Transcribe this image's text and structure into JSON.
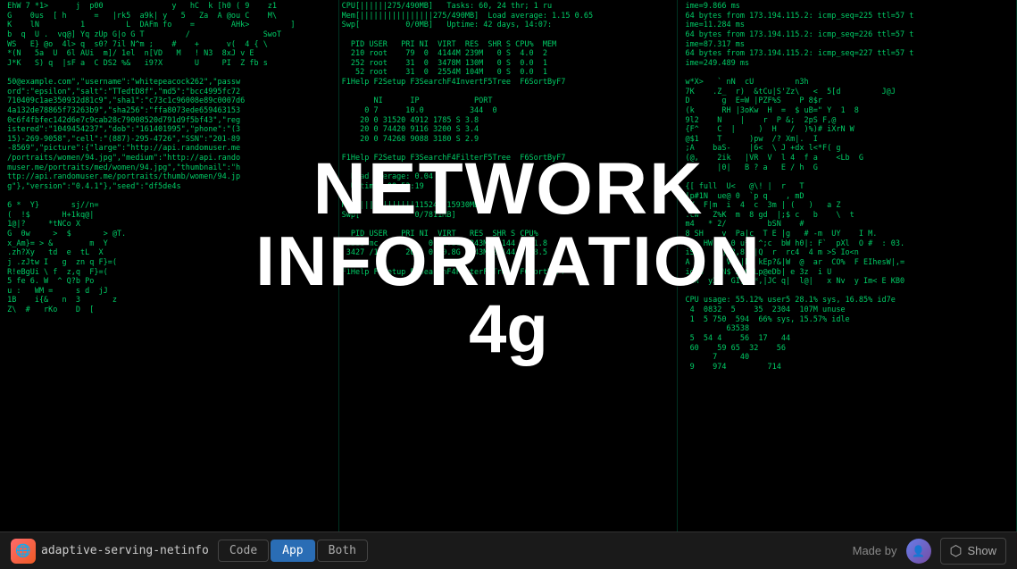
{
  "app": {
    "icon": "🌐",
    "name": "adaptive-serving-netinfo",
    "tabs": [
      {
        "id": "code",
        "label": "Code",
        "active": false
      },
      {
        "id": "app",
        "label": "App",
        "active": true
      },
      {
        "id": "both",
        "label": "Both",
        "active": false
      }
    ]
  },
  "overlay": {
    "line1": "NETWORK",
    "line2": "INFORMATION",
    "line3": "4g"
  },
  "bottom": {
    "made_by": "Made by",
    "show_label": "Show"
  },
  "terminal": {
    "col1_lines": [
      " EhW 7 *1>      j  p00               y   hC  k [h0 ( 9    z1",
      " G    0us  [ h      =   |rk5  a9k| y   5   Za  A @ou C    M\\",
      " K    lN         1         L  DAFm fo    =        AHk>         ]",
      " b  q  U .  vq@] Yq zUp G|o G T         /                SwoT",
      " WS   E} @o  4l> q  s0? 7il N^m ;    #    +      v(  4 { \\",
      " *(N   5a  U  6l AUi  m]/ 1el  n[VD   M   ! N3  8xJ v E",
      " J*K   S) q  |sF a  C DS2 %&   i9?X       U     PI  Z fb s",
      "",
      " 50@example.com\",\"username\":\"whitepeacock262\",\"passw",
      " ord\":\"epsilon\",\"salt\":\"TTedtD8f\",\"md5\":\"bcc4995fc72",
      " 710409c1ae350932d81c9\",\"sha1\":\"c73c1c96008e89c0007d6",
      " 4a132de78865f73263b9\",\"sha256\":\"ffa8073ede659463153",
      " 0c6f4fbfec142d6e7c9cab28c79008520d791d9f5bf43\",\"reg",
      " istered\":\"1049454237\",\"dob\":\"161401995\",\"phone\":\"(3",
      " 15)-269-9058\",\"cell\":\"(887)-295-4726\",\"SSN\":\"201-89",
      " -8569\",\"picture\":{\"large\":\"http://api.randomuser.me",
      " /portraits/women/94.jpg\",\"medium\":\"http://api.rando",
      " muser.me/portraits/med/women/94.jpg\",\"thumbnail\":\"h",
      " ttp://api.randomuser.me/portraits/thumb/women/94.jp",
      " g\"},\"version\":\"0.4.1\"},\"seed\":\"df5de4s",
      "",
      " 6 *  Y}       sj//n=          ",
      " (  !$       H+1kq@|",
      " 1@|?     *tNCo X",
      " G  0w     >  $       > @T.",
      " x_Am}= > &        m  Y",
      " .zh?Xy   td  e  tL  X",
      " j .zJtw I   g  zn q F}=(",
      " R!eBgUi \\ f  z,q  F}=(",
      " 5 fe 6. W  ^ Q?b Po",
      " u :   WM =     s d  jJ",
      " 1B    i{&   n  3       z",
      " Z\\  #   rKo    D  ["
    ],
    "col2_lines": [
      "CPU[||||||275/490MB]   Tasks: 60, 24 thr; 1 ru",
      "Mem[||||||||||||||||275/490MB]  Load average: 1.15 0.65",
      "Swp[          0/0MB]   Uptime: 42 days, 14:07:",
      "",
      "  PID USER   PRI NI  VIRT  RES  SHR S CPU%  MEM",
      "  210 root    79  0  4144M 239M   0 S  4.0  2",
      "  252 root    31  0  3478M 130M   0 S  0.0  1",
      "   52 root    31  0  2554M 104M   0 S  0.0  1",
      "F1Help F2Setup F3SearchF4InvertF5Tree  F6SortByF7",
      "",
      "       NI      IP            PORT",
      "     0 7      10.0          344  0",
      "    20 0 31520 4912 1785 S 3.8",
      "    20 0 74420 9116 3200 S 3.4",
      "    20 0 74268 9088 3180 S 2.9",
      "",
      "F1Help F2Setup F3SearchF4FilterF5Tree  F6SortByF7",
      "",
      "  Load average: 0.04",
      "  Uptime: 09:52:19",
      "",
      "Mem[||||||||||||11524Z/15930MB]",
      "Swp[            0/7811MB]",
      "",
      "  PID USER   PRI NI  VIRT   RES  SHR S CPU%",
      " 3386 mc      20   0 10.8G 2243M 26144 S 31.8",
      " 3427 /1      20   0 10.8G 2243M 26144 R 28.5",
      "",
      "F1Help F2Setup F3SearchF4FilterF5Tree  F6SortByF7"
    ],
    "col3_lines": [
      " ime=9.866 ms",
      " 64 bytes from 173.194.115.2: icmp_seq=225 ttl=57 t",
      " ime=11.284 ms",
      " 64 bytes from 173.194.115.2: icmp_seq=226 ttl=57 t",
      " ime=87.317 ms",
      " 64 bytes from 173.194.115.2: icmp_seq=227 ttl=57 t",
      " ime=249.489 ms",
      "",
      " w*X>   ` nN  cU         n3h",
      " 7K    .Z_  r)  &tCu|S'Zz\\   <  5[d         J@J",
      " D       g  E=W |PZF%S    P 8$r",
      " (k      RH |3oKw  H  =  $ uB=\" Y  1  8",
      " 9l2    N    |    r  P &;  2pS F,@",
      " {F^    C  |     )  H   /  )%)# iXrN W",
      " @$1    T      )pw  /? Xm|.  I",
      " ;A    baS-    |6<  \\ J +dx l<*F( g",
      " (@,    2ik   |VR  V  l 4  f a    <Lb  G",
      "        |0|   B ? a   E / h  G",
      "",
      " {[ full  U<   @\\! |  r   T",
      " |p#1N  ue@ 0  `p q    , mD",
      " IY  F|m  i  4  c  3m | (   )   a Z",
      " .cW   Z%K  m  8 gd  |;$ c   b    \\  t",
      " m4   * 2/         bSN    #",
      " 8 SH    v  Pa|c  T E |g   # -m  UY    I M.",
      " lQ  HW    0 u*  ^;c  bW h0|: F`  pXl  O #  : 03.",
      " iS h  (h] 3,8  |Q  r  rc4  4 m >S Io<n",
      " A &    X V }|k# kEp?&|W  @  ar  CO%  F EIhesW|,=",
      " id G   QN$ X4C Lp@eDb| e 3z  i U",
      " ;nN  y33  GI, 1*,|JC q|  l@|   x Nv  y Im< E KB0",
      "",
      " CPU usage: 55.12% user5 28.1% sys, 16.85% id7e",
      "  4  0832  5    35  2304  107M unuse",
      "  1  5 750  594  66% sys, 15.57% idle",
      "          63538",
      "  5  54 4    56  17   44",
      "  60    59 65  32    56",
      "       7     40",
      "  9    974         714"
    ]
  }
}
